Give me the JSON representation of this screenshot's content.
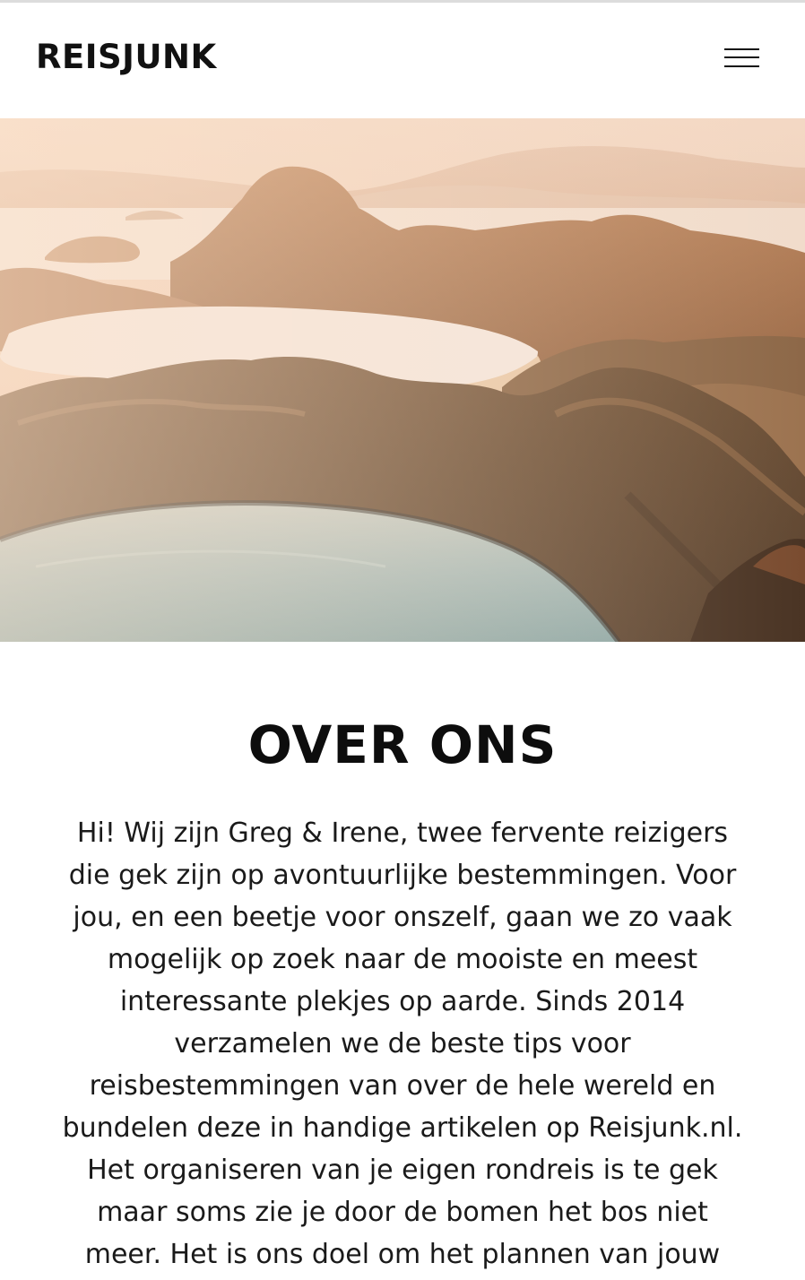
{
  "header": {
    "logo_text": "REISJUNK",
    "menu_icon": "hamburger-menu-icon"
  },
  "hero": {
    "image_description_icon": "landscape-photo"
  },
  "main": {
    "title": "OVER ONS",
    "intro_lines": [
      "Hi! Wij zijn Greg & Irene, twee fervente reizigers",
      "die gek zijn op avontuurlijke bestemmingen. Voor",
      "jou, en een beetje voor onszelf, gaan we zo vaak",
      "mogelijk op zoek naar de mooiste en meest",
      "interessante plekjes op aarde. Sinds 2014",
      "verzamelen we de beste tips voor",
      "reisbestemmingen van over de hele wereld en",
      "bundelen deze in handige artikelen op Reisjunk.nl.",
      "Het organiseren van je eigen rondreis is te gek",
      "maar soms zie je door de bomen het bos niet",
      "meer. Het is ons doel om het plannen van jouw"
    ]
  },
  "colors": {
    "text": "#111111",
    "background": "#ffffff"
  }
}
